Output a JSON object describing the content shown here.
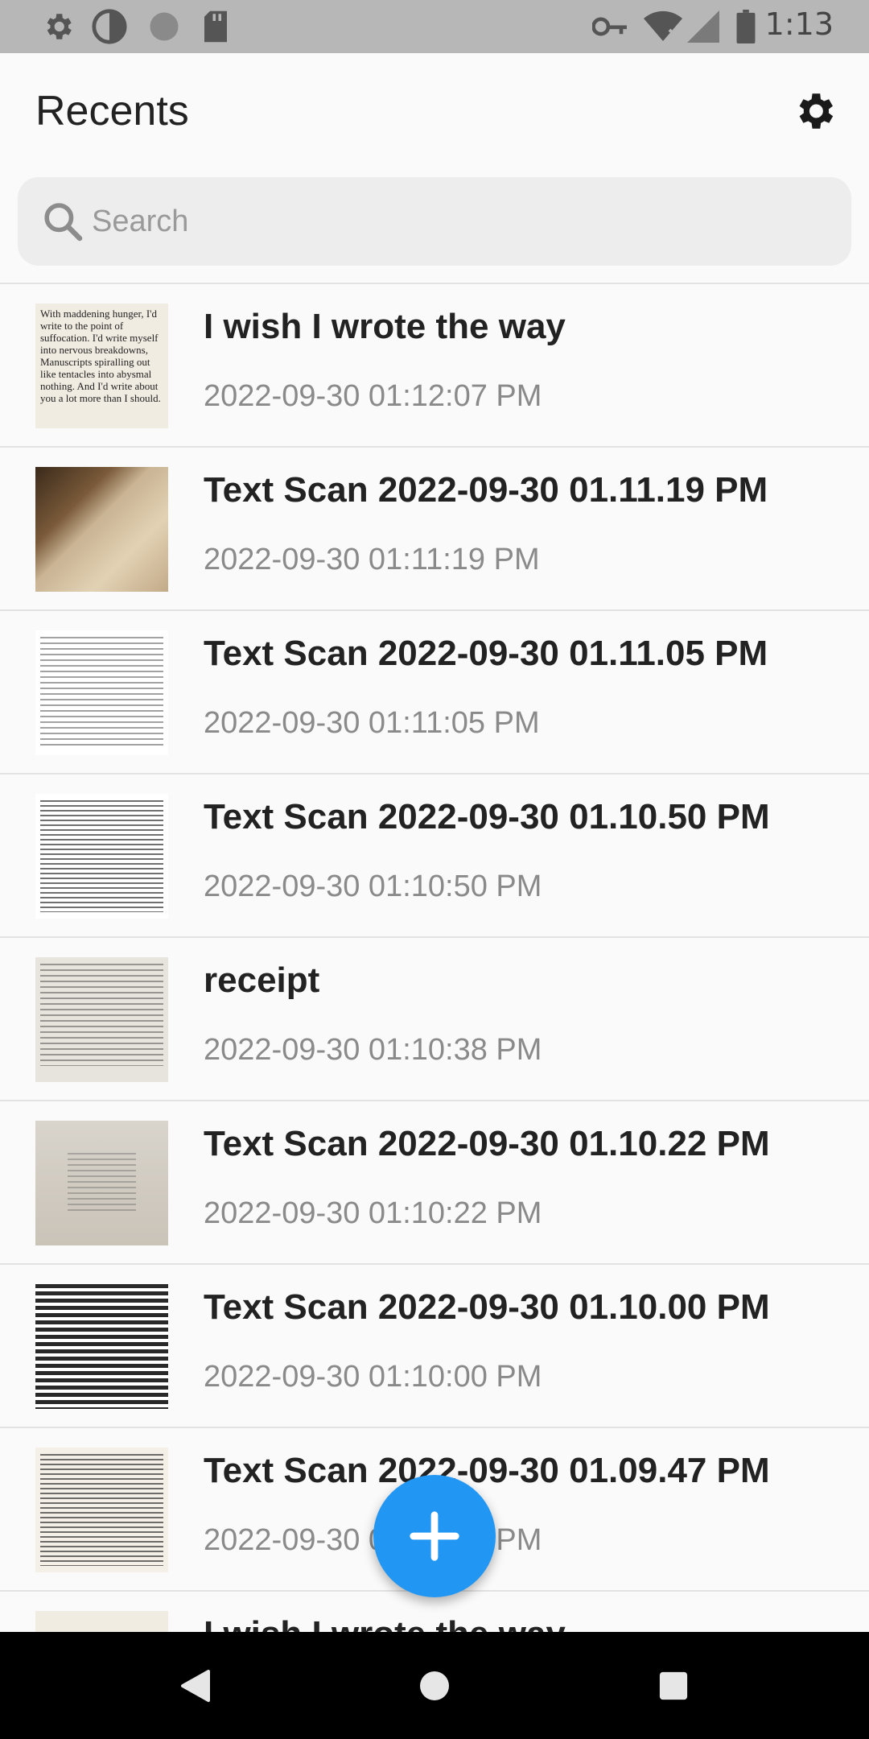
{
  "status_bar": {
    "time": "1:13",
    "icons": [
      "settings-icon",
      "contrast-icon",
      "circle-icon",
      "sd-card-icon",
      "key-icon",
      "wifi-icon",
      "signal-icon",
      "battery-icon"
    ]
  },
  "header": {
    "title": "Recents"
  },
  "search": {
    "placeholder": "Search"
  },
  "items": [
    {
      "title": "I wish I wrote the way",
      "date": "2022-09-30 01:12:07 PM",
      "thumb_text": "With maddening hunger, I'd write to the point of suffocation. I'd write myself into nervous breakdowns, Manuscripts spiralling out like tentacles into abysmal nothing. And I'd write about you a lot more than I should."
    },
    {
      "title": "Text Scan 2022-09-30 01.11.19 PM",
      "date": "2022-09-30 01:11:19 PM"
    },
    {
      "title": "Text Scan 2022-09-30 01.11.05 PM",
      "date": "2022-09-30 01:11:05 PM"
    },
    {
      "title": "Text Scan 2022-09-30 01.10.50 PM",
      "date": "2022-09-30 01:10:50 PM"
    },
    {
      "title": "receipt",
      "date": "2022-09-30 01:10:38 PM"
    },
    {
      "title": "Text Scan 2022-09-30 01.10.22 PM",
      "date": "2022-09-30 01:10:22 PM"
    },
    {
      "title": "Text Scan 2022-09-30 01.10.00 PM",
      "date": "2022-09-30 01:10:00 PM"
    },
    {
      "title": "Text Scan 2022-09-30 01.09.47 PM",
      "date": "2022-09-30 01:09:47 PM"
    },
    {
      "title": "I wish I wrote the way",
      "date": ""
    }
  ],
  "colors": {
    "accent": "#2196f3",
    "status_bar": "#b7b7b7",
    "nav_bar": "#000000"
  }
}
